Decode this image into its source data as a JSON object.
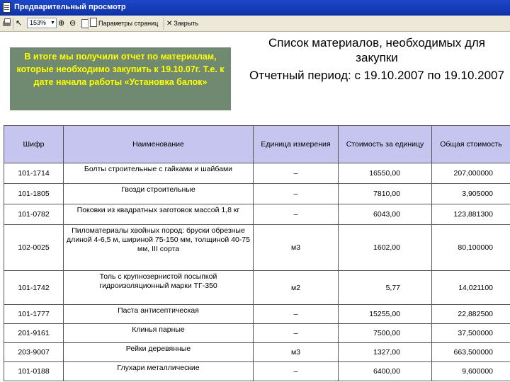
{
  "window": {
    "title": "Предварительный просмотр"
  },
  "toolbar": {
    "zoom_value": "153%",
    "page_setup_label": "Параметры страниц",
    "close_label": "Закрыть"
  },
  "note": {
    "text": "В итоге мы получили отчет по материалам, которые необходимо закупить к 19.10.07г. Т.е. к дате начала работы «Установка балок»"
  },
  "report": {
    "title": "Список материалов, необходимых для закупки",
    "period": "Отчетный период: с 19.10.2007 по 19.10.2007"
  },
  "table": {
    "headers": {
      "code": "Шифр",
      "name": "Наименование",
      "unit": "Единица измерения",
      "price": "Стоимость за единицу",
      "total": "Общая стоимость"
    },
    "rows": [
      {
        "code": "101-1714",
        "name": "Болты строительные с гайками и шайбами",
        "unit": "–",
        "price": "16550,00",
        "total": "207,000000"
      },
      {
        "code": "101-1805",
        "name": "Гвозди строительные",
        "unit": "–",
        "price": "7810,00",
        "total": "3,905000"
      },
      {
        "code": "101-0782",
        "name": "Поковки из квадратных заготовок массой 1,8 кг",
        "unit": "–",
        "price": "6043,00",
        "total": "123,881300"
      },
      {
        "code": "102-0025",
        "name": "Пиломатериалы хвойных пород: бруски обрезные длиной 4-6,5 м, шириной 75-150 мм, толщиной 40-75 мм, III сорта",
        "unit": "м3",
        "price": "1602,00",
        "total": "80,100000"
      },
      {
        "code": "101-1742",
        "name": "Толь с крупнозернистой посыпкой гидроизоляционный марки ТГ-350",
        "unit": "м2",
        "price": "5,77",
        "total": "14,021100"
      },
      {
        "code": "101-1777",
        "name": "Паста антисептическая",
        "unit": "–",
        "price": "15255,00",
        "total": "22,882500"
      },
      {
        "code": "201-9161",
        "name": "Клинья парные",
        "unit": "–",
        "price": "7500,00",
        "total": "37,500000"
      },
      {
        "code": "203-9007",
        "name": "Рейки деревянные",
        "unit": "м3",
        "price": "1327,00",
        "total": "663,500000"
      },
      {
        "code": "101-0188",
        "name": "Глухари металлические",
        "unit": "–",
        "price": "6400,00",
        "total": "9,600000"
      }
    ]
  }
}
